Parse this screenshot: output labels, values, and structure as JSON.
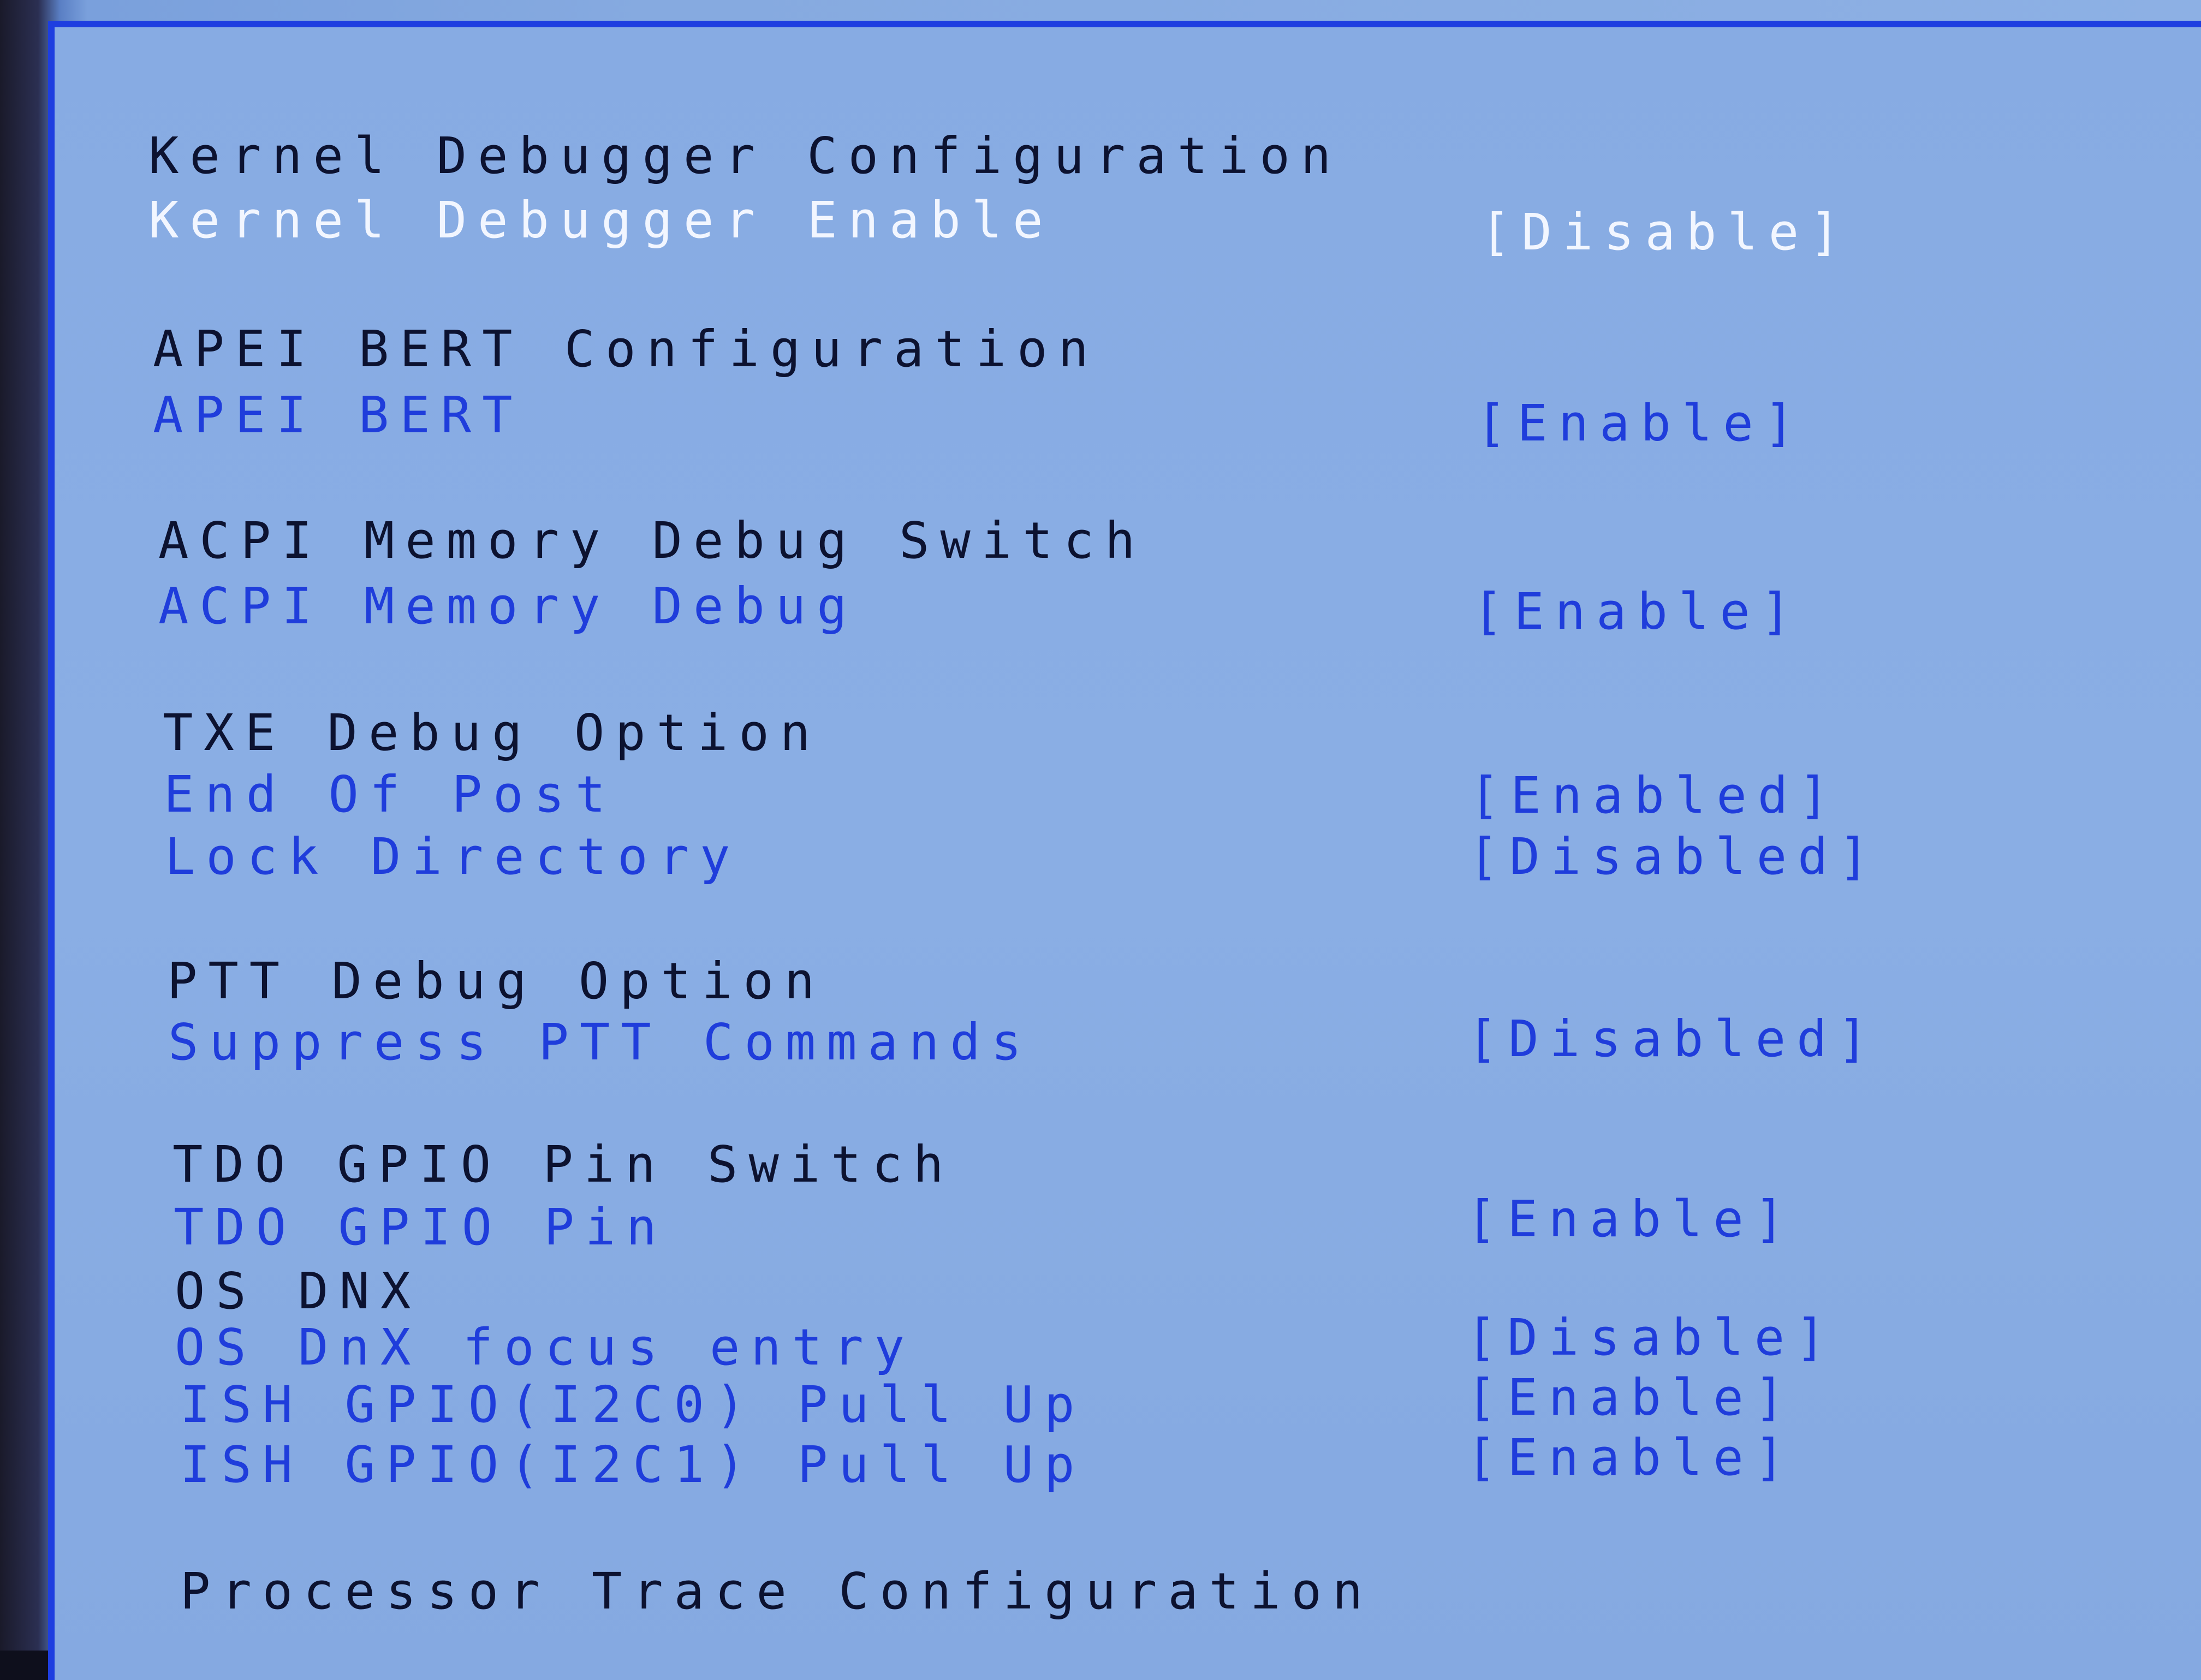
{
  "sections": [
    {
      "heading": "Kernel Debugger Configuration",
      "items": [
        {
          "label": "Kernel Debugger Enable",
          "value": "[Disable]",
          "selected": true
        }
      ]
    },
    {
      "heading": "APEI BERT Configuration",
      "items": [
        {
          "label": "APEI BERT",
          "value": "[Enable]"
        }
      ]
    },
    {
      "heading": "ACPI Memory Debug Switch",
      "items": [
        {
          "label": "ACPI Memory Debug",
          "value": "[Enable]"
        }
      ]
    },
    {
      "heading": "TXE Debug Option",
      "items": [
        {
          "label": "End Of Post",
          "value": "[Enabled]"
        },
        {
          "label": "Lock Directory",
          "value": "[Disabled]"
        }
      ]
    },
    {
      "heading": "PTT Debug Option",
      "items": [
        {
          "label": "Suppress PTT Commands",
          "value": "[Disabled]"
        }
      ]
    },
    {
      "heading": "TDO GPIO Pin Switch",
      "items": [
        {
          "label": "TDO GPIO Pin",
          "value": "[Enable]"
        }
      ]
    },
    {
      "heading": "OS DNX",
      "items": [
        {
          "label": "OS DnX focus entry",
          "value": "[Disable]"
        },
        {
          "label": "ISH GPIO(I2C0) Pull Up",
          "value": "[Enable]"
        },
        {
          "label": "ISH GPIO(I2C1) Pull Up",
          "value": "[Enable]"
        }
      ]
    },
    {
      "heading": "Processor Trace Configuration",
      "items": []
    }
  ],
  "colors": {
    "background": "#87abe3",
    "frame_border": "#1e3ee0",
    "heading_text": "#0c1230",
    "option_text": "#1f3ddb",
    "selected_text": "#f2f6ff"
  }
}
